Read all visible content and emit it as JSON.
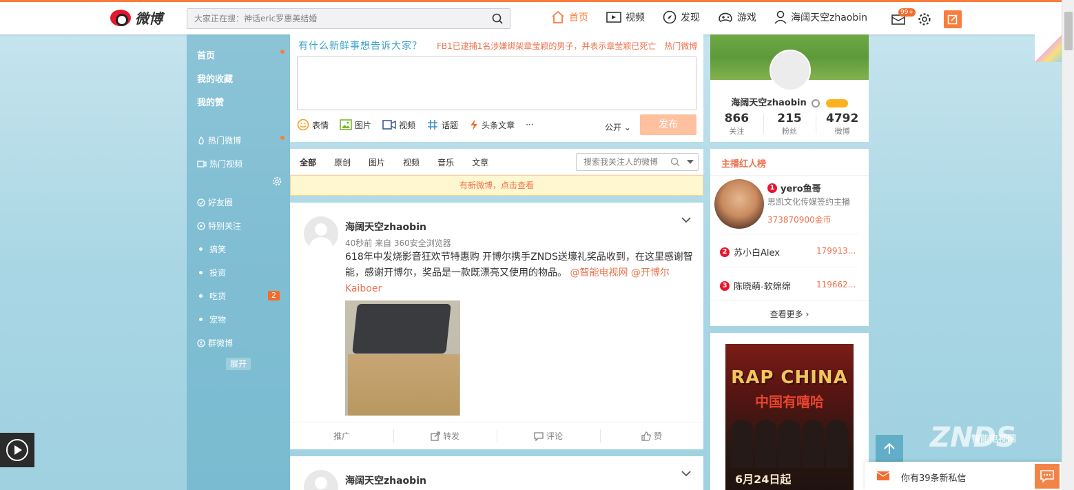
{
  "header": {
    "logo_text": "微博",
    "search_placeholder": "大家正在搜：神话eric罗惠美结婚",
    "nav": [
      {
        "label": "首页",
        "icon": "home-icon",
        "active": true
      },
      {
        "label": "视频",
        "icon": "video-icon"
      },
      {
        "label": "发现",
        "icon": "compass-icon"
      },
      {
        "label": "游戏",
        "icon": "game-icon"
      },
      {
        "label": "海阔天空zhaobin",
        "icon": "user-icon"
      }
    ],
    "message_badge": "99+"
  },
  "left_nav": {
    "items": [
      {
        "label": "首页"
      },
      {
        "label": "我的收藏"
      },
      {
        "label": "我的赞"
      },
      {
        "label": "热门微博"
      },
      {
        "label": "热门视频"
      },
      {
        "label": "好友圈"
      },
      {
        "label": "特别关注"
      },
      {
        "label": "搞笑"
      },
      {
        "label": "投资"
      },
      {
        "label": "吃货",
        "badge": "2"
      },
      {
        "label": "宠物"
      },
      {
        "label": "群微博"
      }
    ],
    "expand_label": "展开"
  },
  "composer": {
    "slogan": "有什么新鲜事想告诉大家？",
    "hot_topic": "FB1已逮捕1名涉嫌绑架章莹颖的男子，并表示章莹颖已死亡",
    "hot_link": "热门微博",
    "tools": [
      "表情",
      "图片",
      "视频",
      "话题",
      "头条文章",
      "···"
    ],
    "visibility": "公开",
    "send_label": "发布"
  },
  "feed_tabs": {
    "tabs": [
      "全部",
      "原创",
      "图片",
      "视频",
      "音乐",
      "文章"
    ],
    "search_placeholder": "搜索我关注人的微博",
    "new_notice": "有新微博，点击查看"
  },
  "post": {
    "author": "海阔天空zhaobin",
    "meta": "40秒前 来自 360安全浏览器",
    "text": "618年中发烧影音狂欢节特惠购 开博尔携手ZNDS送壕礼奖品收到，在这里感谢智能，感谢开博尔，奖品是一款既漂亮又使用的物品。",
    "mention1": "@智能电视网",
    "mention2": "@开博尔Kaiboer",
    "actions": [
      "推广",
      "转发",
      "评论",
      "赞"
    ]
  },
  "post2": {
    "author": "海阔天空zhaobin"
  },
  "profile": {
    "name": "海阔天空zhaobin",
    "stats": [
      {
        "num": "866",
        "label": "关注"
      },
      {
        "num": "215",
        "label": "粉丝"
      },
      {
        "num": "4792",
        "label": "微博"
      }
    ]
  },
  "rank": {
    "title": "主播红人榜",
    "first": {
      "rank": "1",
      "name": "yero鱼哥",
      "desc": "思凯文化传媒签约主播",
      "coins": "373870900金币"
    },
    "others": [
      {
        "rank": "2",
        "name": "苏小白Alex",
        "value": "179913..."
      },
      {
        "rank": "3",
        "name": "陈晓萌-软绵绵",
        "value": "119662..."
      }
    ],
    "more": "查看更多"
  },
  "ad": {
    "title": "RAP CHINA",
    "subtitle": "中国有嘻哈",
    "date": "6月24日起"
  },
  "private_msg": "你有39条新私信",
  "watermark": "ZNDS",
  "watermark_sub": "智能电视网",
  "colors": {
    "accent": "#fa7d3c",
    "link": "#eb7350"
  }
}
